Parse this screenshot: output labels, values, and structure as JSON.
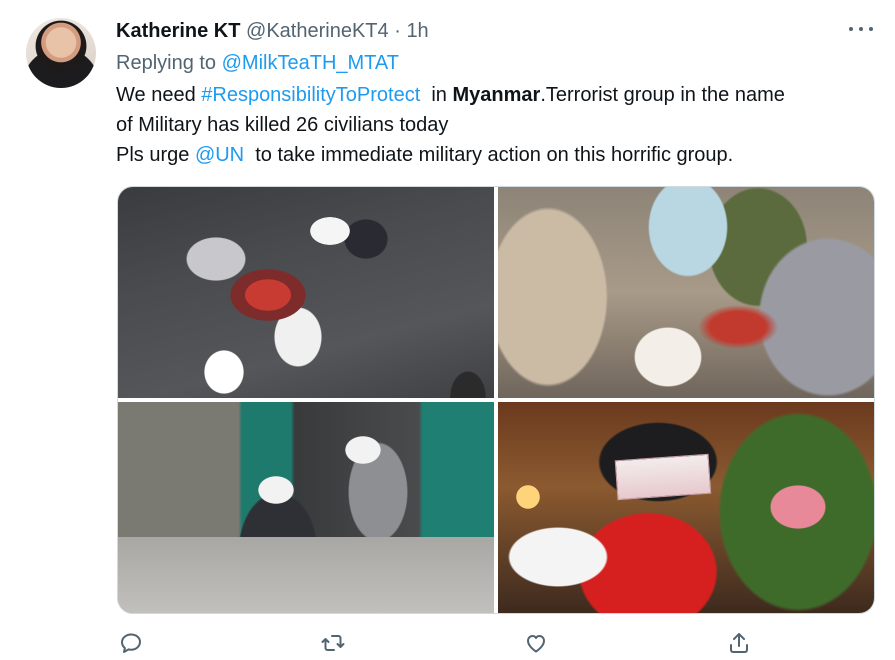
{
  "author": {
    "name": "Katherine KT",
    "handle": "@KatherineKT4",
    "separator": "·",
    "time": "1h"
  },
  "reply": {
    "prefix": "Replying to",
    "to": "@MilkTeaTH_MTAT"
  },
  "body": {
    "l1_a": "We need ",
    "l1_hashtag": "#ResponsibilityToProtect",
    "l1_b": "  in ",
    "l1_bold": "Myanmar",
    "l1_c": ".Terrorist group in the name",
    "l2": "of Military has killed 26 civilians today",
    "l3_a": "Pls urge ",
    "l3_mention": "@UN",
    "l3_b": "  to take immediate military action on this horrific group."
  },
  "icons": {
    "more": "more-icon",
    "reply": "reply-icon",
    "retweet": "retweet-icon",
    "like": "like-icon",
    "share": "share-icon"
  },
  "colors": {
    "link": "#1d9bf0",
    "secondary": "#536471",
    "text": "#0f1419"
  }
}
